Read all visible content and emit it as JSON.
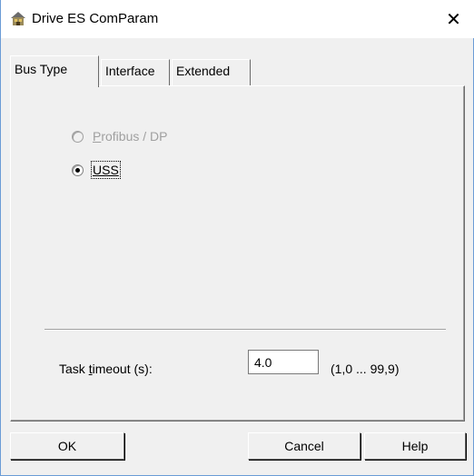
{
  "window": {
    "title": "Drive ES ComParam",
    "close_glyph": "✕"
  },
  "tabs": [
    {
      "label": "Bus Type",
      "active": true
    },
    {
      "label": "Interface",
      "active": false
    },
    {
      "label": "Extended",
      "active": false
    }
  ],
  "bus_type": {
    "options": [
      {
        "label_mnemonic": "P",
        "label_rest": "rofibus / DP",
        "selected": false,
        "enabled": false
      },
      {
        "label": "USS",
        "selected": true,
        "enabled": true
      }
    ]
  },
  "timeout": {
    "label_prefix": "Task ",
    "label_mnemonic": "t",
    "label_suffix": "imeout (s):",
    "value": "4.0",
    "range": "(1,0 ... 99,9)"
  },
  "buttons": {
    "ok": "OK",
    "cancel": "Cancel",
    "help": "Help"
  },
  "icons": {
    "app": "network-drive-icon",
    "close": "close-icon"
  }
}
